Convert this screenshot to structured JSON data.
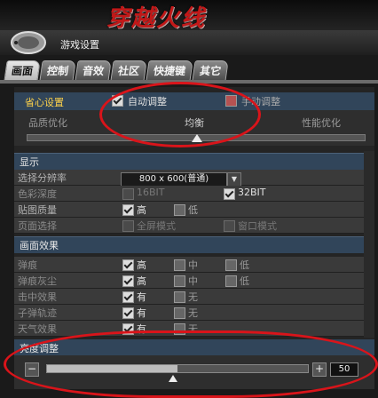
{
  "header": {
    "logo_text": "穿越火线"
  },
  "window": {
    "title": "游戏设置"
  },
  "tabs": [
    {
      "label": "画面",
      "active": true
    },
    {
      "label": "控制",
      "active": false
    },
    {
      "label": "音效",
      "active": false
    },
    {
      "label": "社区",
      "active": false
    },
    {
      "label": "快捷键",
      "active": false
    },
    {
      "label": "其它",
      "active": false
    }
  ],
  "preset": {
    "title": "省心设置",
    "auto_label": "自动调整",
    "auto_checked": true,
    "manual_label": "手动调整",
    "manual_checked": false,
    "left_label": "品质优化",
    "center_label": "均衡",
    "right_label": "性能优化"
  },
  "display": {
    "title": "显示",
    "resolution_label": "选择分辨率",
    "resolution_value": "800 x 600(普通)",
    "color_label": "色彩深度",
    "color_16": "16BIT",
    "color_32": "32BIT",
    "texture_label": "贴图质量",
    "texture_high": "高",
    "texture_low": "低",
    "page_label": "页面选择",
    "fullscreen_label": "全屏模式",
    "window_label": "窗口模式"
  },
  "effects": {
    "title": "画面效果",
    "rows": [
      {
        "label": "弹痕",
        "opts": [
          "高",
          "中",
          "低"
        ]
      },
      {
        "label": "弹痕灰尘",
        "opts": [
          "高",
          "中",
          "低"
        ]
      },
      {
        "label": "击中效果",
        "opts": [
          "有",
          "无"
        ]
      },
      {
        "label": "子弹轨迹",
        "opts": [
          "有",
          "无"
        ]
      },
      {
        "label": "天气效果",
        "opts": [
          "有",
          "无"
        ]
      }
    ]
  },
  "brightness": {
    "title": "亮度调整",
    "minus": "−",
    "plus": "+",
    "value": "50",
    "level": 0.5
  },
  "colors": {
    "annotation": "#d9141a",
    "section_header": "#31455a",
    "preset_title": "#ffd34a"
  }
}
